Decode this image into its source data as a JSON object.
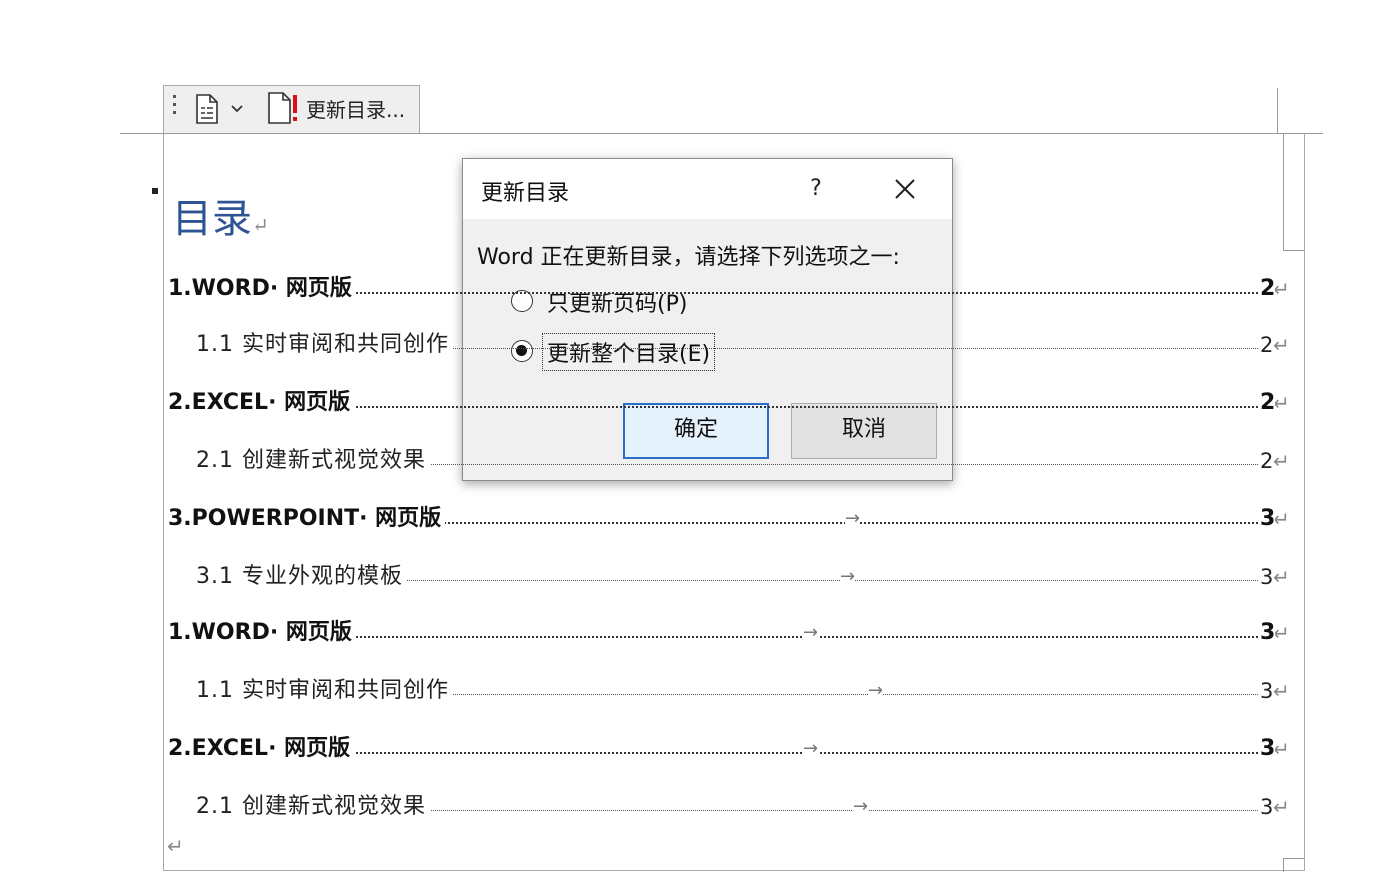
{
  "toolbar": {
    "doc_icon": "document-icon",
    "dropdown_icon": "chevron-down-icon",
    "update_icon": "update-toc-icon",
    "update_label": "更新目录..."
  },
  "document": {
    "heading": "目录",
    "paragraph_mark": "↵",
    "tab_mark": "→",
    "toc": [
      {
        "level": 1,
        "title": "1.WORD· 网页版",
        "page": "2"
      },
      {
        "level": 2,
        "title": "1.1 实时审阅和共同创作",
        "page": "2"
      },
      {
        "level": 1,
        "title": "2.EXCEL· 网页版",
        "page": "2"
      },
      {
        "level": 2,
        "title": "2.1 创建新式视觉效果",
        "page": "2"
      },
      {
        "level": 1,
        "title": "3.POWERPOINT· 网页版",
        "page": "3"
      },
      {
        "level": 2,
        "title": "3.1 专业外观的模板",
        "page": "3"
      },
      {
        "level": 1,
        "title": "1.WORD· 网页版",
        "page": "3"
      },
      {
        "level": 2,
        "title": "1.1 实时审阅和共同创作",
        "page": "3"
      },
      {
        "level": 1,
        "title": "2.EXCEL· 网页版",
        "page": "3"
      },
      {
        "level": 2,
        "title": "2.1 创建新式视觉效果",
        "page": "3"
      }
    ]
  },
  "dialog": {
    "title": "更新目录",
    "help_label": "?",
    "close_icon": "close-icon",
    "prompt": "Word 正在更新目录，请选择下列选项之一:",
    "options": [
      {
        "label": "只更新页码(P)",
        "selected": false
      },
      {
        "label": "更新整个目录(E)",
        "selected": true
      }
    ],
    "ok_label": "确定",
    "cancel_label": "取消",
    "accent_color": "#2b6fc4"
  }
}
